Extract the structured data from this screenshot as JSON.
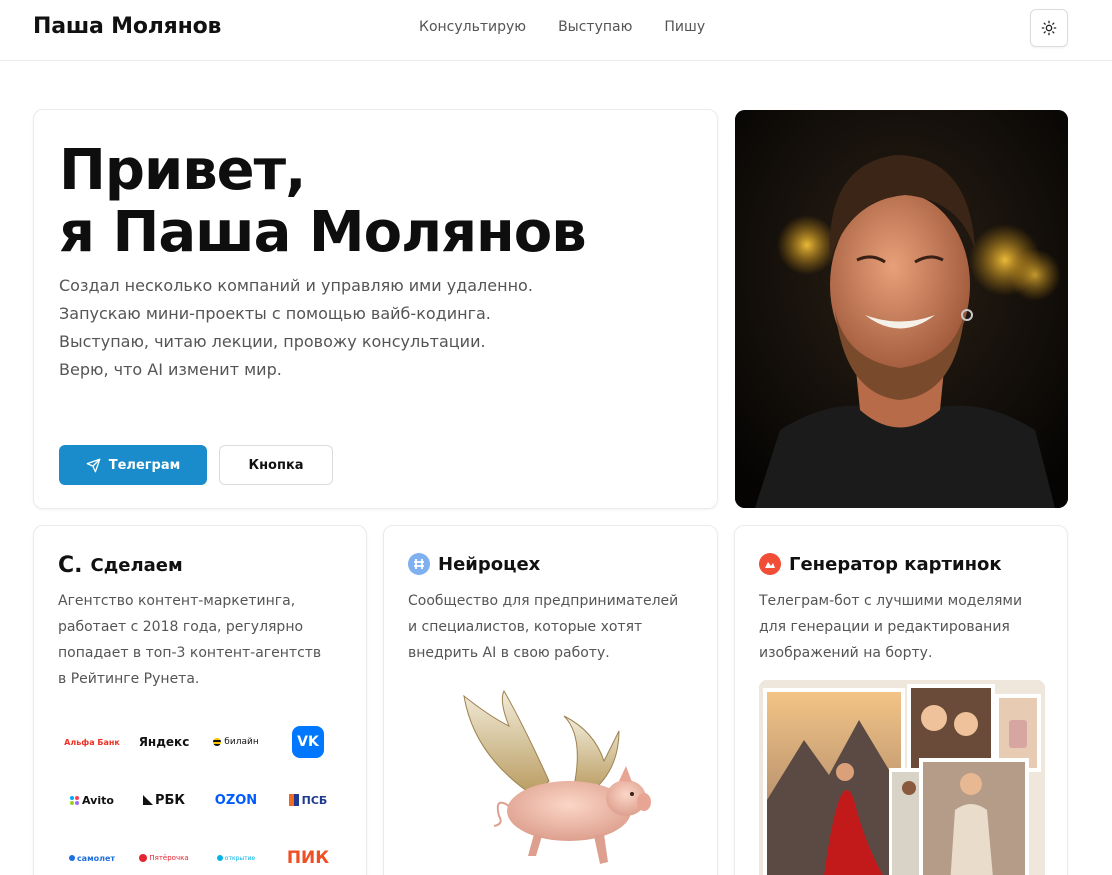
{
  "header": {
    "brand": "Паша Молянов",
    "nav": [
      {
        "label": "Консультирую"
      },
      {
        "label": "Выступаю"
      },
      {
        "label": "Пишу"
      }
    ],
    "theme_icon": "sun-icon"
  },
  "hero": {
    "title_line1": "Привет,",
    "title_line2": "я Паша Молянов",
    "lines": [
      "Создал несколько компаний и управляю ими удаленно.",
      "Запускаю мини-проекты с помощью вайб-кодинга.",
      "Выступаю, читаю лекции, провожу консультации.",
      "Верю, что AI изменит мир."
    ],
    "primary_button": "Телеграм",
    "secondary_button": "Кнопка",
    "colors": {
      "accent": "#1a8ccc"
    }
  },
  "projects": [
    {
      "title": "Сделаем",
      "logo_text": "С.",
      "lines": [
        "Агентство контент-маркетинга,",
        "работает с 2018 года, регулярно",
        "попадает в топ-3 контент-агентств",
        "в Рейтинге Рунета."
      ],
      "clients": [
        {
          "name": "Альфа Банк",
          "color": "#ef3124"
        },
        {
          "name": "Яндекс",
          "color": "#111111"
        },
        {
          "name": "билайн",
          "color": "#111111"
        },
        {
          "name": "VK",
          "color": "#0077ff"
        },
        {
          "name": "Avito",
          "color": "#111111"
        },
        {
          "name": "РБК",
          "color": "#111111"
        },
        {
          "name": "OZON",
          "color": "#005bff"
        },
        {
          "name": "ПСБ",
          "color": "#1d3a8f"
        },
        {
          "name": "самолет",
          "color": "#1f6fe0"
        },
        {
          "name": "Пятёрочка",
          "color": "#e3262f"
        },
        {
          "name": "открытие",
          "color": "#00b4e6"
        },
        {
          "name": "ПИК",
          "color": "#f04e23"
        }
      ]
    },
    {
      "title": "Нейроцех",
      "lines": [
        "Сообщество для предпринимателей",
        "и специалистов, которые хотят",
        "внедрить AI в свою работу."
      ]
    },
    {
      "title": "Генератор картинок",
      "lines": [
        "Телеграм-бот с лучшими моделями",
        "для генерации и редактирования",
        "изображений на борту."
      ]
    }
  ]
}
